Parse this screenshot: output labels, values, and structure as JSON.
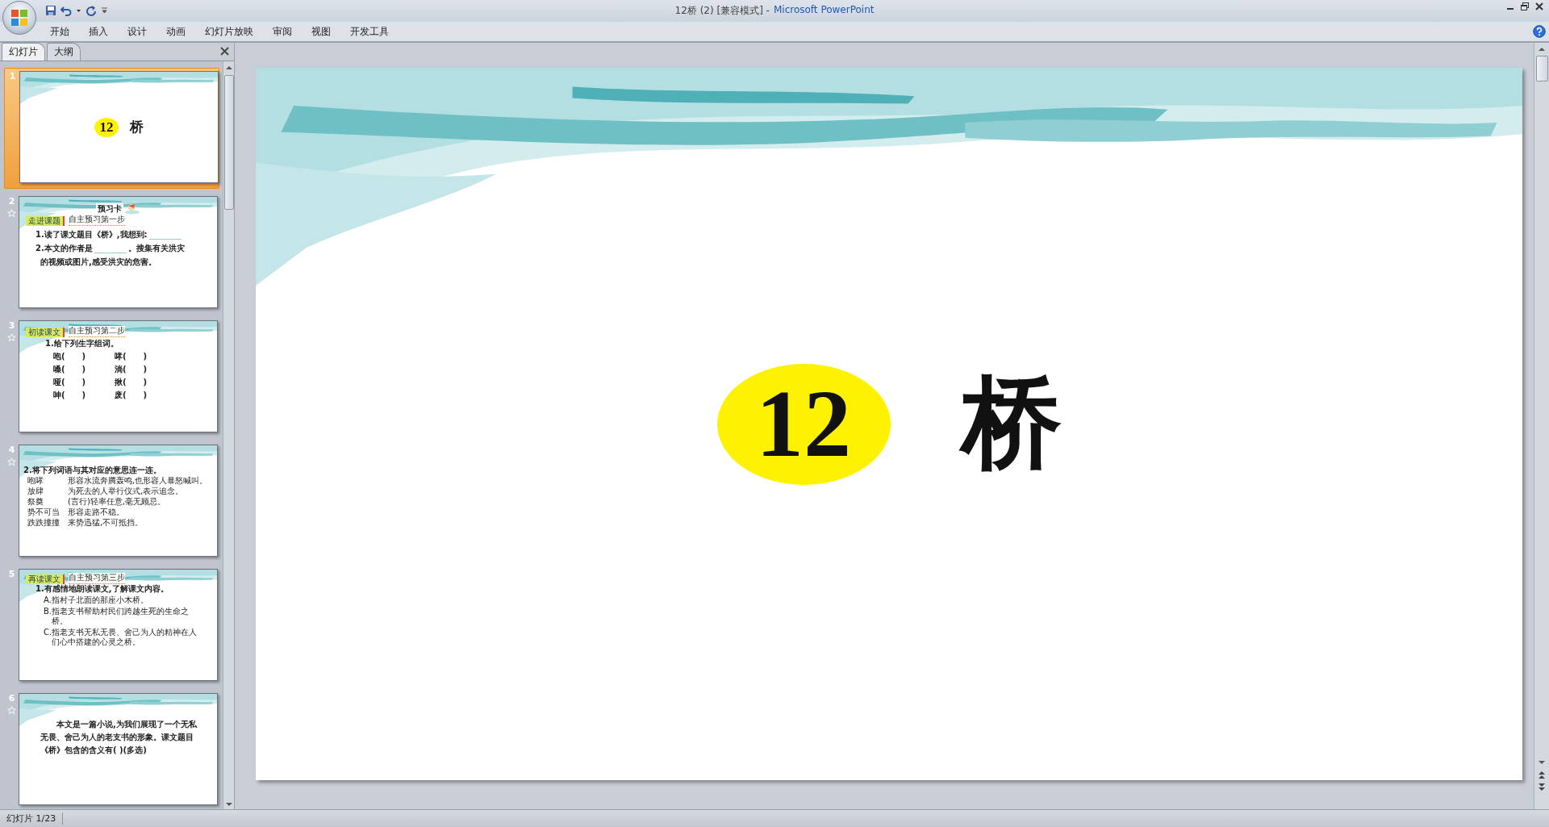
{
  "window": {
    "title": "12桥 (2) [兼容模式] -",
    "app": "Microsoft PowerPoint"
  },
  "ribbon_tabs": [
    {
      "label": "开始",
      "selected": false
    },
    {
      "label": "插入",
      "selected": false
    },
    {
      "label": "设计",
      "selected": false
    },
    {
      "label": "动画",
      "selected": false
    },
    {
      "label": "幻灯片放映",
      "selected": false
    },
    {
      "label": "审阅",
      "selected": false
    },
    {
      "label": "视图",
      "selected": false
    },
    {
      "label": "开发工具",
      "selected": false
    }
  ],
  "pane_tabs": [
    {
      "label": "幻灯片",
      "selected": true
    },
    {
      "label": "大纲",
      "selected": false
    }
  ],
  "slides": [
    {
      "kind": "title",
      "number": "1",
      "selected": true,
      "animated": false,
      "badge": "12",
      "title": "桥"
    },
    {
      "kind": "card",
      "number": "2",
      "selected": false,
      "animated": true,
      "heading": "预习卡",
      "tag": "走进课题",
      "step": "自主预习第一步",
      "lines": [
        {
          "text": "1.读了课文题目《桥》,我想到:",
          "blank": true
        },
        {
          "text": "2.本文的作者是",
          "blank": true,
          "after": "。搜集有关洪灾"
        },
        {
          "text": "的视频或图片,感受洪灾的危害。",
          "blank": false
        }
      ]
    },
    {
      "kind": "grid",
      "number": "3",
      "selected": false,
      "animated": true,
      "tag": "初读课文",
      "step": "自主预习第二步",
      "question": "1.给下列生字组词。",
      "items": [
        "咆(      )",
        "哮(      )",
        "嗓(      )",
        "淌(      )",
        "哑(      )",
        "揪(      )",
        "呻(      )",
        "废(      )"
      ]
    },
    {
      "kind": "matching",
      "number": "4",
      "selected": false,
      "animated": true,
      "question": "2.将下列词语与其对应的意思连一连。",
      "pairs": [
        {
          "word": "咆哮",
          "meaning": "形容水流奔腾轰鸣,也形容人暴怒喊叫。"
        },
        {
          "word": "放肆",
          "meaning": "为死去的人举行仪式,表示追念。"
        },
        {
          "word": "祭奠",
          "meaning": "(言行)轻率任意,毫无顾忌。"
        },
        {
          "word": "势不可当",
          "meaning": "形容走路不稳。"
        },
        {
          "word": "跌跌撞撞",
          "meaning": "来势迅猛,不可抵挡。"
        }
      ]
    },
    {
      "kind": "choices",
      "number": "5",
      "selected": false,
      "animated": false,
      "tag": "再读课文",
      "step": "自主预习第三步",
      "question": "1.有感情地朗读课文,了解课文内容。",
      "options": [
        "A.指村子北面的那座小木桥。",
        "B.指老支书帮助村民们跨越生死的生命之桥。",
        "C.指老支书无私无畏、舍己为人的精神在人们心中搭建的心灵之桥。"
      ]
    },
    {
      "kind": "paragraph",
      "number": "6",
      "selected": false,
      "animated": true,
      "text": "本文是一篇小说,为我们展现了一个无私无畏、舍己为人的老支书的形象。课文题目《桥》包含的含义有(      )(多选)"
    }
  ],
  "slide": {
    "badge": "12",
    "title": "桥"
  },
  "status_bar": {
    "slide_position": "幻灯片 1/23"
  }
}
